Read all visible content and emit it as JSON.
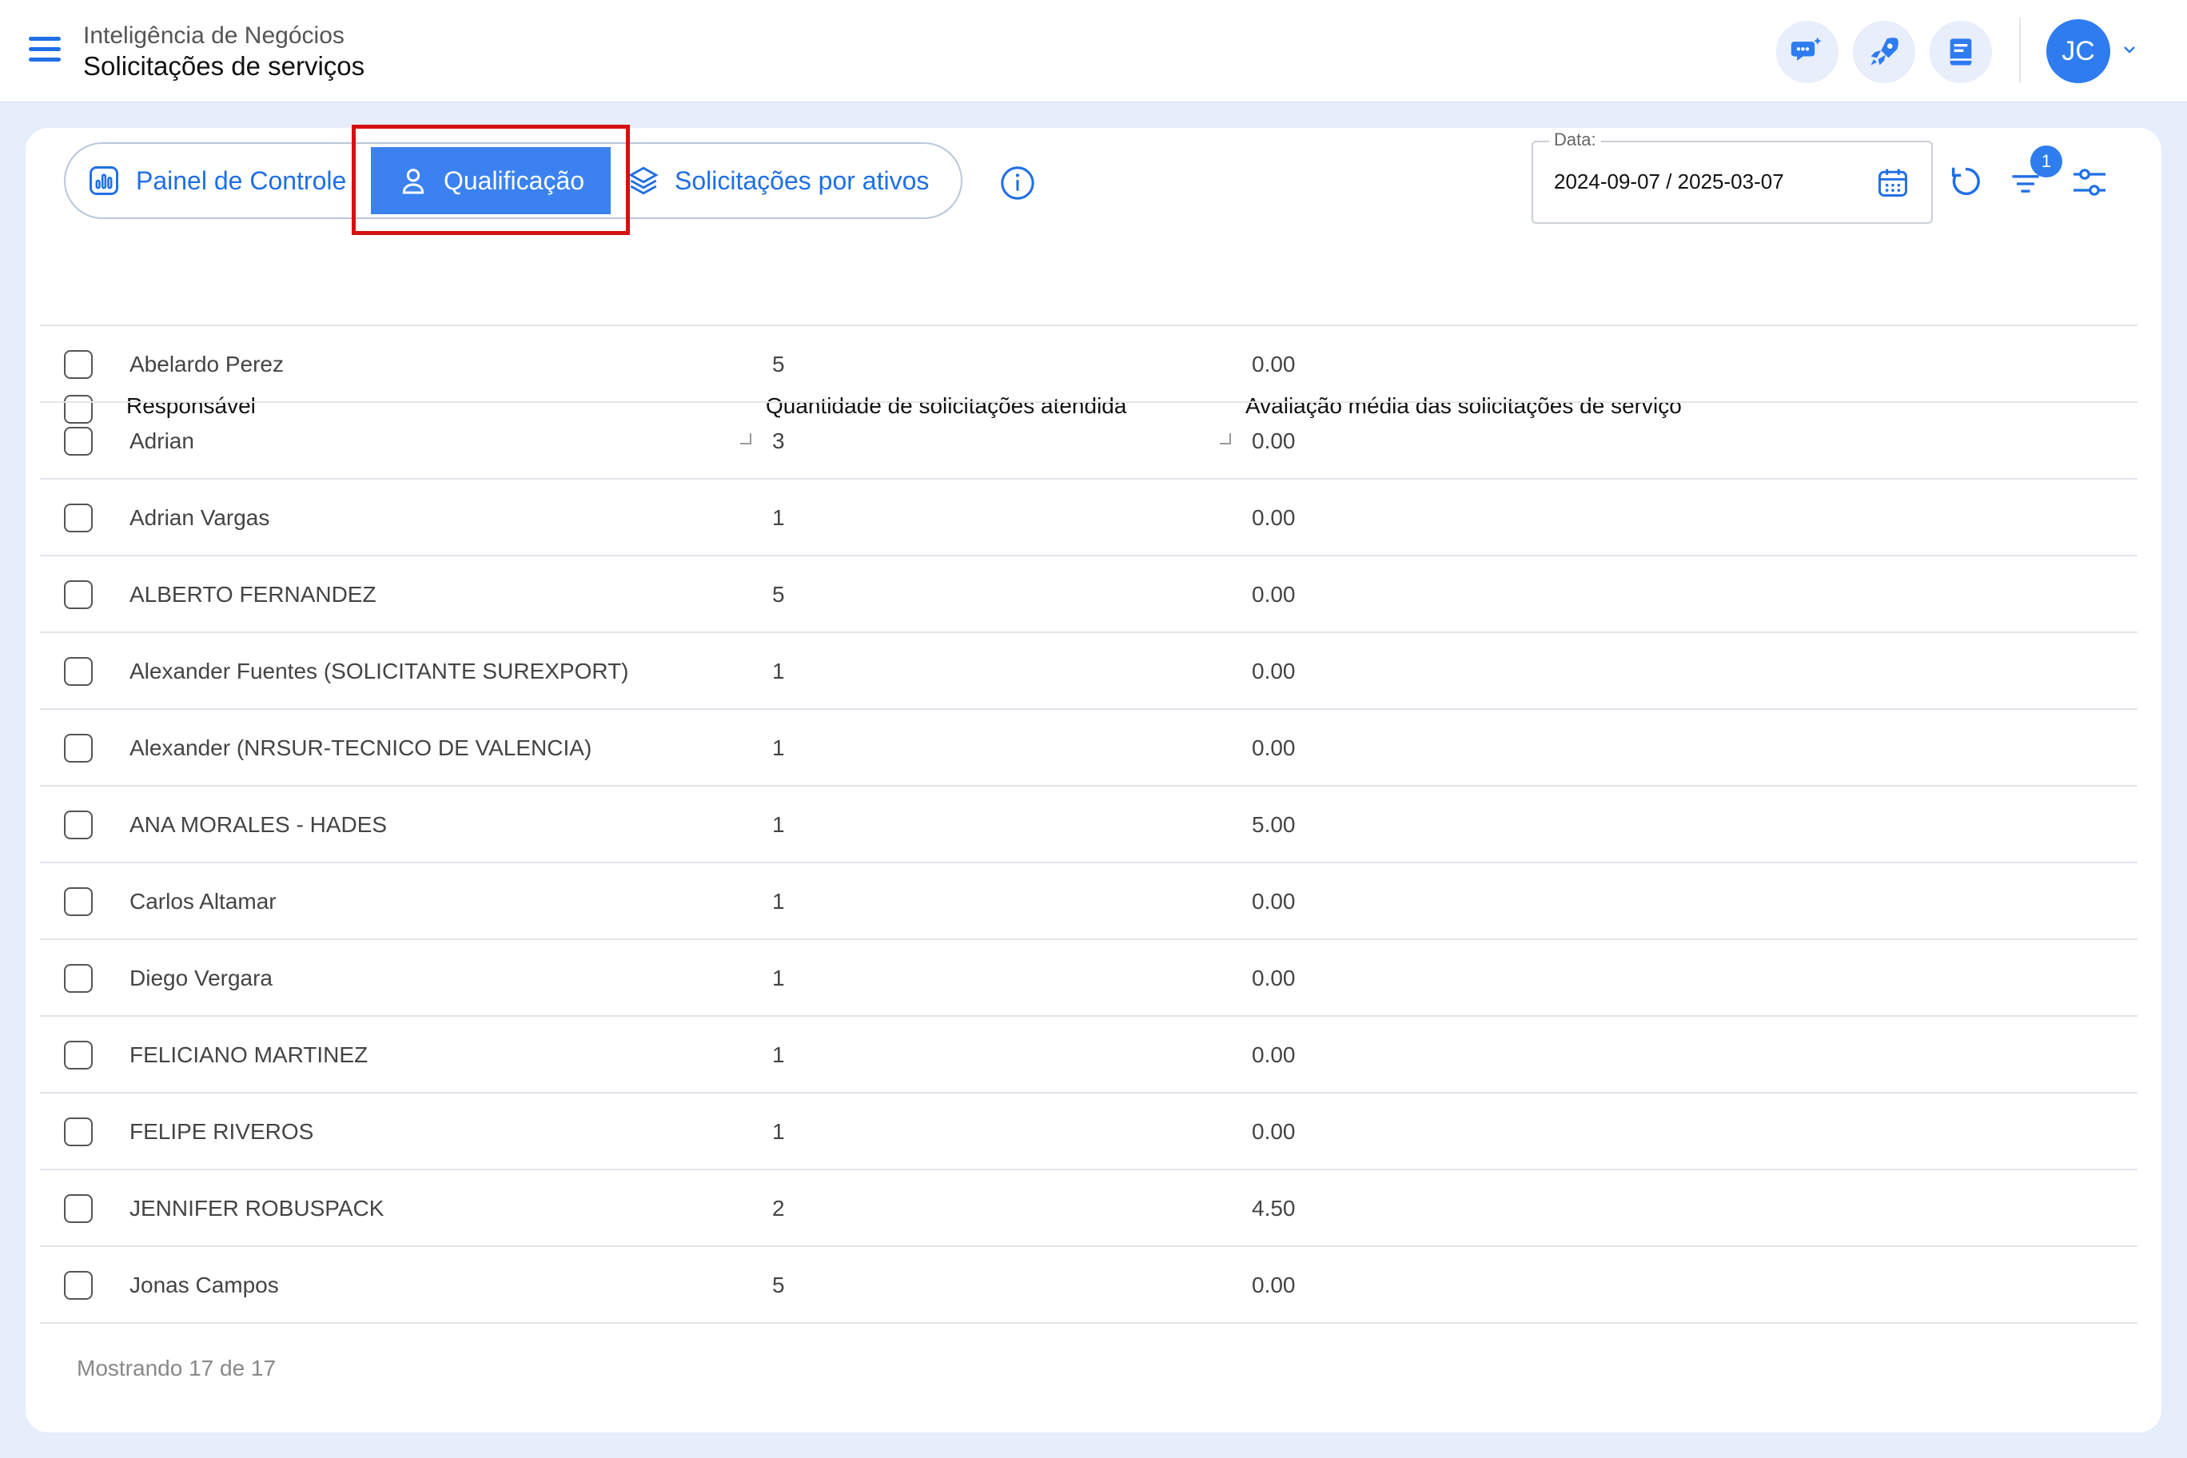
{
  "header": {
    "app_name": "Inteligência de Negócios",
    "page_title": "Solicitações de serviços",
    "avatar_initials": "JC"
  },
  "tabs": [
    {
      "label": "Painel de Controle",
      "icon": "chart-icon",
      "active": false
    },
    {
      "label": "Qualificação",
      "icon": "user-icon",
      "active": true
    },
    {
      "label": "Solicitações por ativos",
      "icon": "layers-icon",
      "active": false
    }
  ],
  "toolbar": {
    "date_label": "Data:",
    "date_value": "2024-09-07 / 2025-03-07",
    "filter_count": "1"
  },
  "table": {
    "columns": [
      "Responsável",
      "Quantidade de solicitações atendida",
      "Avaliação média das solicitações de serviço"
    ],
    "rows": [
      {
        "name": "Abelardo Perez",
        "qty": "5",
        "avg": "0.00"
      },
      {
        "name": "Adrian",
        "qty": "3",
        "avg": "0.00"
      },
      {
        "name": "Adrian Vargas",
        "qty": "1",
        "avg": "0.00"
      },
      {
        "name": "ALBERTO FERNANDEZ",
        "qty": "5",
        "avg": "0.00"
      },
      {
        "name": "Alexander Fuentes (SOLICITANTE SUREXPORT)",
        "qty": "1",
        "avg": "0.00"
      },
      {
        "name": "Alexander (NRSUR-TECNICO DE VALENCIA)",
        "qty": "1",
        "avg": "0.00"
      },
      {
        "name": "ANA MORALES - HADES",
        "qty": "1",
        "avg": "5.00"
      },
      {
        "name": "Carlos Altamar",
        "qty": "1",
        "avg": "0.00"
      },
      {
        "name": "Diego Vergara",
        "qty": "1",
        "avg": "0.00"
      },
      {
        "name": "FELICIANO MARTINEZ",
        "qty": "1",
        "avg": "0.00"
      },
      {
        "name": "FELIPE RIVEROS",
        "qty": "1",
        "avg": "0.00"
      },
      {
        "name": "JENNIFER ROBUSPACK",
        "qty": "2",
        "avg": "4.50"
      },
      {
        "name": "Jonas Campos",
        "qty": "5",
        "avg": "0.00"
      }
    ]
  },
  "footer": {
    "status": "Mostrando 17 de 17"
  },
  "colors": {
    "accent": "#2e7cf0",
    "highlight": "#d61010",
    "background": "#e6eefc"
  }
}
